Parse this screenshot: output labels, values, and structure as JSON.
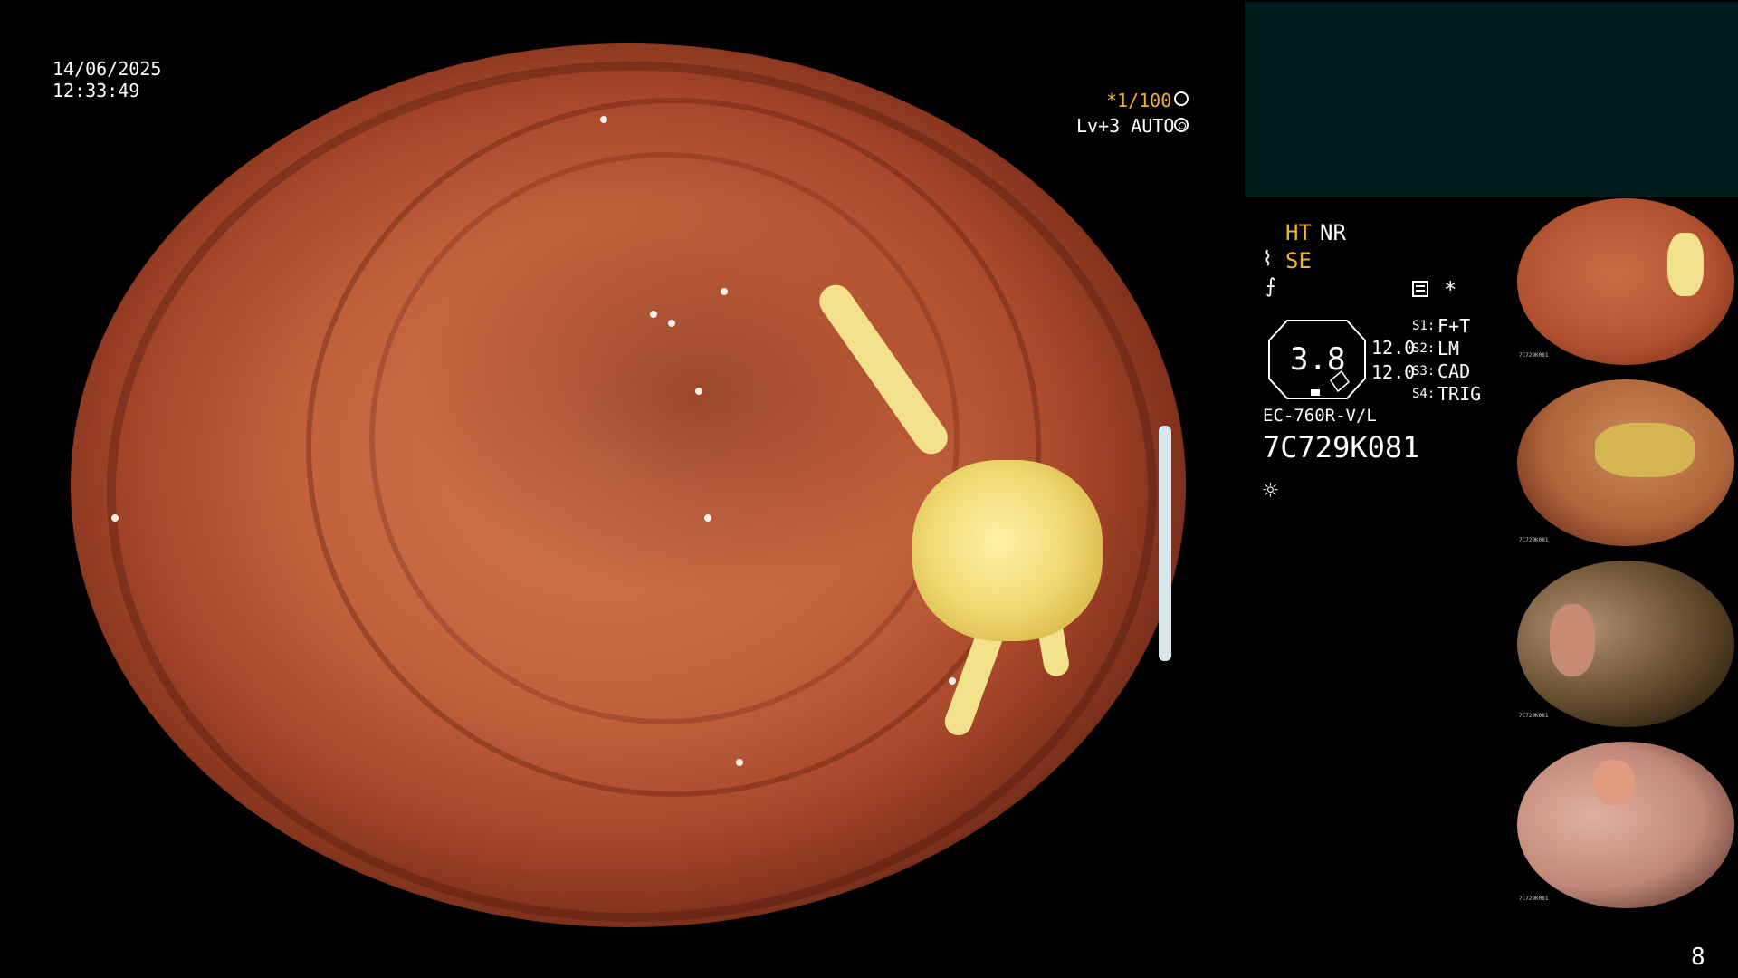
{
  "overlay": {
    "date": "14/06/2025",
    "time": "12:33:49",
    "shutter": "*1/100",
    "shutter_icon": "aperture-icon",
    "level": "Lv+3 AUTO",
    "level_icon": "target-icon"
  },
  "settings": {
    "ht": "HT",
    "nr": "NR",
    "se": "SE",
    "se_icon": "pump-icon",
    "f_icon": "freeze-icon",
    "memo_icon": "memo-icon",
    "asterisk": "*",
    "zoom": "3.8",
    "val1": "12.0",
    "val2": "12.0",
    "s1_label": "S1:",
    "s1_value": "F+T",
    "s2_label": "S2:",
    "s2_value": "LM",
    "s3_label": "S3:",
    "s3_value": "CAD",
    "s4_label": "S4:",
    "s4_value": "TRIG",
    "scope_model": "EC-760R-V/L",
    "serial": "7C729K081",
    "light_icon": "light-sun-icon"
  },
  "thumbnails": [
    {
      "label": "7C729K081"
    },
    {
      "label": "7C729K081"
    },
    {
      "label": "7C729K081"
    },
    {
      "label": "7C729K081"
    }
  ],
  "page_number": "8",
  "colors": {
    "accent_yellow": "#f0b030",
    "panel_teal": "#001c1c",
    "background": "#000000"
  }
}
